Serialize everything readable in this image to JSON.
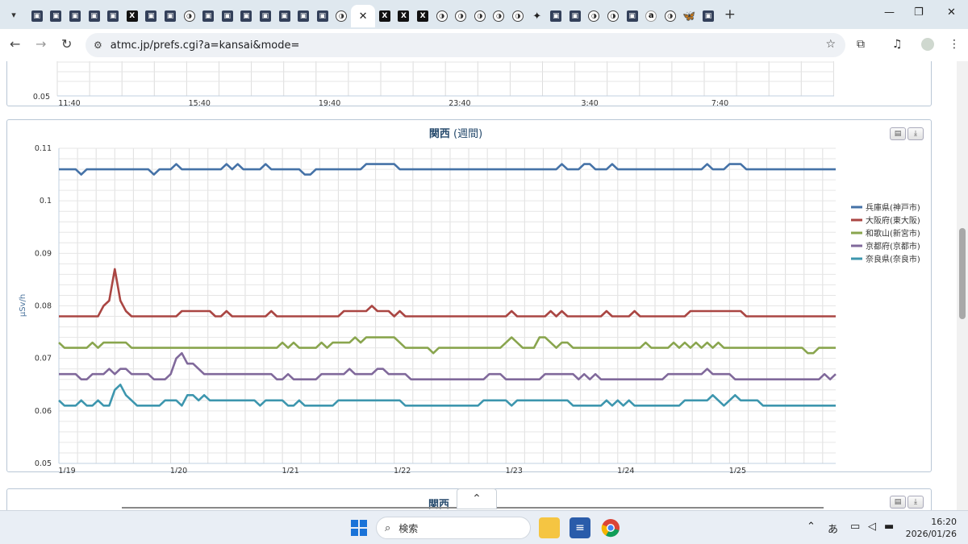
{
  "browser": {
    "tabs": [
      {
        "icon": "site"
      },
      {
        "icon": "site"
      },
      {
        "icon": "site"
      },
      {
        "icon": "site"
      },
      {
        "icon": "site"
      },
      {
        "icon": "x"
      },
      {
        "icon": "site"
      },
      {
        "icon": "site"
      },
      {
        "icon": "circ"
      },
      {
        "icon": "site"
      },
      {
        "icon": "site"
      },
      {
        "icon": "site"
      },
      {
        "icon": "site"
      },
      {
        "icon": "site"
      },
      {
        "icon": "site"
      },
      {
        "icon": "site"
      },
      {
        "icon": "circ"
      },
      {
        "icon": "close",
        "active": true
      },
      {
        "icon": "x"
      },
      {
        "icon": "x"
      },
      {
        "icon": "x"
      },
      {
        "icon": "circ"
      },
      {
        "icon": "circ"
      },
      {
        "icon": "circ"
      },
      {
        "icon": "circ"
      },
      {
        "icon": "circ"
      },
      {
        "icon": "star4"
      },
      {
        "icon": "site"
      },
      {
        "icon": "site"
      },
      {
        "icon": "circ"
      },
      {
        "icon": "circ"
      },
      {
        "icon": "site"
      },
      {
        "icon": "amz"
      },
      {
        "icon": "circ"
      },
      {
        "icon": "bsky"
      },
      {
        "icon": "site"
      }
    ],
    "url": "atmc.jp/prefs.cgi?a=kansai&mode="
  },
  "top_panel": {
    "y_tick": "0.05",
    "x_ticks": [
      "11:40",
      "15:40",
      "19:40",
      "23:40",
      "3:40",
      "7:40"
    ]
  },
  "main_panel": {
    "title": "関西",
    "title_suffix": "(週間)"
  },
  "bottom_panel": {
    "title": "関西"
  },
  "chart_data": {
    "type": "line",
    "title": "関西 (週間)",
    "ylabel": "μSv/h",
    "xlabel": "",
    "ylim": [
      0.05,
      0.11
    ],
    "y_ticks": [
      "0.05",
      "0.06",
      "0.07",
      "0.08",
      "0.09",
      "0.1",
      "0.11"
    ],
    "x_ticks": [
      "1/19",
      "1/20",
      "1/21",
      "1/22",
      "1/23",
      "1/24",
      "1/25"
    ],
    "grid": true,
    "legend_position": "right",
    "series": [
      {
        "name": "兵庫県(神戸市)",
        "color": "#4572a7",
        "points": [
          [
            0,
            0.106
          ],
          [
            0.15,
            0.106
          ],
          [
            0.2,
            0.105
          ],
          [
            0.25,
            0.106
          ],
          [
            0.8,
            0.106
          ],
          [
            0.85,
            0.105
          ],
          [
            0.9,
            0.106
          ],
          [
            1.0,
            0.106
          ],
          [
            1.05,
            0.107
          ],
          [
            1.1,
            0.106
          ],
          [
            1.45,
            0.106
          ],
          [
            1.5,
            0.107
          ],
          [
            1.55,
            0.106
          ],
          [
            1.6,
            0.107
          ],
          [
            1.65,
            0.106
          ],
          [
            1.8,
            0.106
          ],
          [
            1.85,
            0.107
          ],
          [
            1.9,
            0.106
          ],
          [
            2.15,
            0.106
          ],
          [
            2.2,
            0.105
          ],
          [
            2.25,
            0.105
          ],
          [
            2.3,
            0.106
          ],
          [
            2.7,
            0.106
          ],
          [
            2.75,
            0.107
          ],
          [
            3.0,
            0.107
          ],
          [
            3.05,
            0.106
          ],
          [
            4.45,
            0.106
          ],
          [
            4.5,
            0.107
          ],
          [
            4.55,
            0.106
          ],
          [
            4.65,
            0.106
          ],
          [
            4.7,
            0.107
          ],
          [
            4.75,
            0.107
          ],
          [
            4.8,
            0.106
          ],
          [
            4.9,
            0.106
          ],
          [
            4.95,
            0.107
          ],
          [
            5.0,
            0.106
          ],
          [
            5.75,
            0.106
          ],
          [
            5.8,
            0.107
          ],
          [
            5.85,
            0.106
          ],
          [
            5.95,
            0.106
          ],
          [
            6.0,
            0.107
          ],
          [
            6.1,
            0.107
          ],
          [
            6.15,
            0.106
          ],
          [
            6.95,
            0.106
          ]
        ]
      },
      {
        "name": "大阪府(東大阪)",
        "color": "#aa4643",
        "points": [
          [
            0,
            0.078
          ],
          [
            0.35,
            0.078
          ],
          [
            0.4,
            0.08
          ],
          [
            0.45,
            0.081
          ],
          [
            0.5,
            0.087
          ],
          [
            0.55,
            0.081
          ],
          [
            0.6,
            0.079
          ],
          [
            0.65,
            0.078
          ],
          [
            1.05,
            0.078
          ],
          [
            1.1,
            0.079
          ],
          [
            1.35,
            0.079
          ],
          [
            1.4,
            0.078
          ],
          [
            1.45,
            0.078
          ],
          [
            1.5,
            0.079
          ],
          [
            1.55,
            0.078
          ],
          [
            1.85,
            0.078
          ],
          [
            1.9,
            0.079
          ],
          [
            1.95,
            0.078
          ],
          [
            2.5,
            0.078
          ],
          [
            2.55,
            0.079
          ],
          [
            2.75,
            0.079
          ],
          [
            2.8,
            0.08
          ],
          [
            2.85,
            0.079
          ],
          [
            2.95,
            0.079
          ],
          [
            3.0,
            0.078
          ],
          [
            3.05,
            0.079
          ],
          [
            3.1,
            0.078
          ],
          [
            4.0,
            0.078
          ],
          [
            4.05,
            0.079
          ],
          [
            4.1,
            0.078
          ],
          [
            4.35,
            0.078
          ],
          [
            4.4,
            0.079
          ],
          [
            4.45,
            0.078
          ],
          [
            4.5,
            0.079
          ],
          [
            4.55,
            0.078
          ],
          [
            4.85,
            0.078
          ],
          [
            4.9,
            0.079
          ],
          [
            4.95,
            0.078
          ],
          [
            5.1,
            0.078
          ],
          [
            5.15,
            0.079
          ],
          [
            5.2,
            0.078
          ],
          [
            5.6,
            0.078
          ],
          [
            5.65,
            0.079
          ],
          [
            6.1,
            0.079
          ],
          [
            6.15,
            0.078
          ],
          [
            6.95,
            0.078
          ]
        ]
      },
      {
        "name": "和歌山(新宮市)",
        "color": "#89a54e",
        "points": [
          [
            0,
            0.073
          ],
          [
            0.05,
            0.072
          ],
          [
            0.25,
            0.072
          ],
          [
            0.3,
            0.073
          ],
          [
            0.35,
            0.072
          ],
          [
            0.4,
            0.073
          ],
          [
            0.6,
            0.073
          ],
          [
            0.65,
            0.072
          ],
          [
            1.95,
            0.072
          ],
          [
            2.0,
            0.073
          ],
          [
            2.05,
            0.072
          ],
          [
            2.1,
            0.073
          ],
          [
            2.15,
            0.072
          ],
          [
            2.3,
            0.072
          ],
          [
            2.35,
            0.073
          ],
          [
            2.4,
            0.072
          ],
          [
            2.45,
            0.073
          ],
          [
            2.6,
            0.073
          ],
          [
            2.65,
            0.074
          ],
          [
            2.7,
            0.073
          ],
          [
            2.75,
            0.074
          ],
          [
            3.0,
            0.074
          ],
          [
            3.05,
            0.073
          ],
          [
            3.1,
            0.072
          ],
          [
            3.3,
            0.072
          ],
          [
            3.35,
            0.071
          ],
          [
            3.4,
            0.072
          ],
          [
            3.95,
            0.072
          ],
          [
            4.05,
            0.074
          ],
          [
            4.1,
            0.073
          ],
          [
            4.15,
            0.072
          ],
          [
            4.25,
            0.072
          ],
          [
            4.3,
            0.074
          ],
          [
            4.35,
            0.074
          ],
          [
            4.4,
            0.073
          ],
          [
            4.45,
            0.072
          ],
          [
            4.5,
            0.073
          ],
          [
            4.55,
            0.073
          ],
          [
            4.6,
            0.072
          ],
          [
            5.2,
            0.072
          ],
          [
            5.25,
            0.073
          ],
          [
            5.3,
            0.072
          ],
          [
            5.45,
            0.072
          ],
          [
            5.5,
            0.073
          ],
          [
            5.55,
            0.072
          ],
          [
            5.6,
            0.073
          ],
          [
            5.65,
            0.072
          ],
          [
            5.7,
            0.073
          ],
          [
            5.75,
            0.072
          ],
          [
            5.8,
            0.073
          ],
          [
            5.85,
            0.072
          ],
          [
            5.9,
            0.073
          ],
          [
            5.95,
            0.072
          ],
          [
            6.65,
            0.072
          ],
          [
            6.7,
            0.071
          ],
          [
            6.75,
            0.071
          ],
          [
            6.8,
            0.072
          ],
          [
            6.95,
            0.072
          ]
        ]
      },
      {
        "name": "京都府(京都市)",
        "color": "#80699b",
        "points": [
          [
            0,
            0.067
          ],
          [
            0.15,
            0.067
          ],
          [
            0.2,
            0.066
          ],
          [
            0.25,
            0.066
          ],
          [
            0.3,
            0.067
          ],
          [
            0.4,
            0.067
          ],
          [
            0.45,
            0.068
          ],
          [
            0.5,
            0.067
          ],
          [
            0.55,
            0.068
          ],
          [
            0.6,
            0.068
          ],
          [
            0.65,
            0.067
          ],
          [
            0.8,
            0.067
          ],
          [
            0.85,
            0.066
          ],
          [
            0.95,
            0.066
          ],
          [
            1.0,
            0.067
          ],
          [
            1.05,
            0.07
          ],
          [
            1.1,
            0.071
          ],
          [
            1.15,
            0.069
          ],
          [
            1.2,
            0.069
          ],
          [
            1.25,
            0.068
          ],
          [
            1.3,
            0.067
          ],
          [
            1.9,
            0.067
          ],
          [
            1.95,
            0.066
          ],
          [
            2.0,
            0.066
          ],
          [
            2.05,
            0.067
          ],
          [
            2.1,
            0.066
          ],
          [
            2.3,
            0.066
          ],
          [
            2.35,
            0.067
          ],
          [
            2.55,
            0.067
          ],
          [
            2.6,
            0.068
          ],
          [
            2.65,
            0.067
          ],
          [
            2.8,
            0.067
          ],
          [
            2.85,
            0.068
          ],
          [
            2.9,
            0.068
          ],
          [
            2.95,
            0.067
          ],
          [
            3.1,
            0.067
          ],
          [
            3.15,
            0.066
          ],
          [
            3.8,
            0.066
          ],
          [
            3.85,
            0.067
          ],
          [
            3.95,
            0.067
          ],
          [
            4.0,
            0.066
          ],
          [
            4.3,
            0.066
          ],
          [
            4.35,
            0.067
          ],
          [
            4.6,
            0.067
          ],
          [
            4.65,
            0.066
          ],
          [
            4.7,
            0.067
          ],
          [
            4.75,
            0.066
          ],
          [
            4.8,
            0.067
          ],
          [
            4.85,
            0.066
          ],
          [
            5.4,
            0.066
          ],
          [
            5.45,
            0.067
          ],
          [
            5.75,
            0.067
          ],
          [
            5.8,
            0.068
          ],
          [
            5.85,
            0.067
          ],
          [
            6.0,
            0.067
          ],
          [
            6.05,
            0.066
          ],
          [
            6.8,
            0.066
          ],
          [
            6.85,
            0.067
          ],
          [
            6.9,
            0.066
          ],
          [
            6.95,
            0.067
          ]
        ]
      },
      {
        "name": "奈良県(奈良市)",
        "color": "#3d96ae",
        "points": [
          [
            0,
            0.062
          ],
          [
            0.05,
            0.061
          ],
          [
            0.15,
            0.061
          ],
          [
            0.2,
            0.062
          ],
          [
            0.25,
            0.061
          ],
          [
            0.3,
            0.061
          ],
          [
            0.35,
            0.062
          ],
          [
            0.4,
            0.061
          ],
          [
            0.45,
            0.061
          ],
          [
            0.5,
            0.064
          ],
          [
            0.55,
            0.065
          ],
          [
            0.6,
            0.063
          ],
          [
            0.65,
            0.062
          ],
          [
            0.7,
            0.061
          ],
          [
            0.9,
            0.061
          ],
          [
            0.95,
            0.062
          ],
          [
            1.05,
            0.062
          ],
          [
            1.1,
            0.061
          ],
          [
            1.15,
            0.063
          ],
          [
            1.2,
            0.063
          ],
          [
            1.25,
            0.062
          ],
          [
            1.3,
            0.063
          ],
          [
            1.35,
            0.062
          ],
          [
            1.75,
            0.062
          ],
          [
            1.8,
            0.061
          ],
          [
            1.85,
            0.062
          ],
          [
            2.0,
            0.062
          ],
          [
            2.05,
            0.061
          ],
          [
            2.1,
            0.061
          ],
          [
            2.15,
            0.062
          ],
          [
            2.2,
            0.061
          ],
          [
            2.45,
            0.061
          ],
          [
            2.5,
            0.062
          ],
          [
            3.05,
            0.062
          ],
          [
            3.1,
            0.061
          ],
          [
            3.75,
            0.061
          ],
          [
            3.8,
            0.062
          ],
          [
            4.0,
            0.062
          ],
          [
            4.05,
            0.061
          ],
          [
            4.1,
            0.062
          ],
          [
            4.55,
            0.062
          ],
          [
            4.6,
            0.061
          ],
          [
            4.85,
            0.061
          ],
          [
            4.9,
            0.062
          ],
          [
            4.95,
            0.061
          ],
          [
            5.0,
            0.062
          ],
          [
            5.05,
            0.061
          ],
          [
            5.1,
            0.062
          ],
          [
            5.15,
            0.061
          ],
          [
            5.55,
            0.061
          ],
          [
            5.6,
            0.062
          ],
          [
            5.8,
            0.062
          ],
          [
            5.85,
            0.063
          ],
          [
            5.9,
            0.062
          ],
          [
            5.95,
            0.061
          ],
          [
            6.0,
            0.062
          ],
          [
            6.05,
            0.063
          ],
          [
            6.1,
            0.062
          ],
          [
            6.25,
            0.062
          ],
          [
            6.3,
            0.061
          ],
          [
            6.95,
            0.061
          ]
        ]
      }
    ]
  },
  "taskbar": {
    "search_label": "検索",
    "ime": "あ",
    "time": "16:20",
    "date": "2026/01/26"
  }
}
